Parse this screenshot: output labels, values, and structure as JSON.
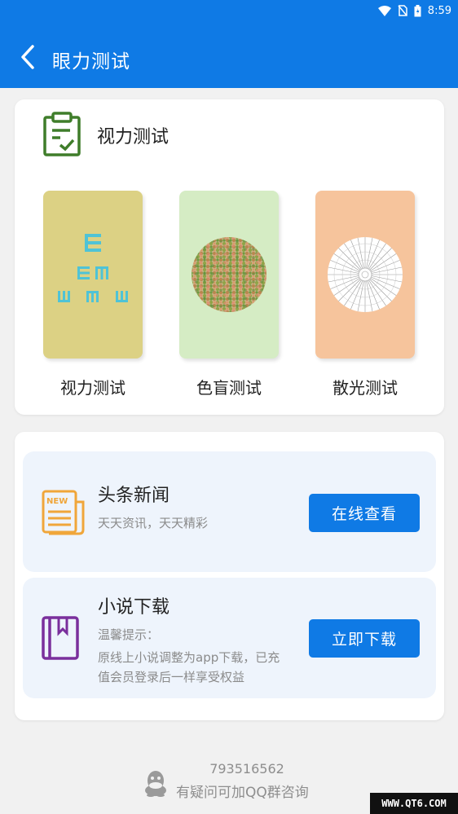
{
  "status_bar": {
    "time": "8:59"
  },
  "header": {
    "title": "眼力测试"
  },
  "vision_section": {
    "title": "视力测试",
    "tests": [
      {
        "label": "视力测试",
        "color": "#dcd184"
      },
      {
        "label": "色盲测试",
        "color": "#d5ecc4"
      },
      {
        "label": "散光测试",
        "color": "#f6c49c"
      }
    ]
  },
  "features": [
    {
      "title": "头条新闻",
      "subtitle": "天天资讯，天天精彩",
      "button": "在线查看",
      "icon": "newspaper-icon"
    },
    {
      "title": "小说下载",
      "subtitle_line1": "温馨提示：",
      "subtitle_line2": "原线上小说调整为app下载，已充",
      "subtitle_line3": "值会员登录后一样享受权益",
      "button": "立即下载",
      "icon": "book-icon"
    }
  ],
  "footer": {
    "qq_number": "793516562",
    "hint": "有疑问可加QQ群咨询"
  },
  "watermark": "WWW.QT6.COM",
  "colors": {
    "primary": "#0f7ae5",
    "background": "#f1f1f1",
    "feature_bg": "#eef4fc"
  }
}
